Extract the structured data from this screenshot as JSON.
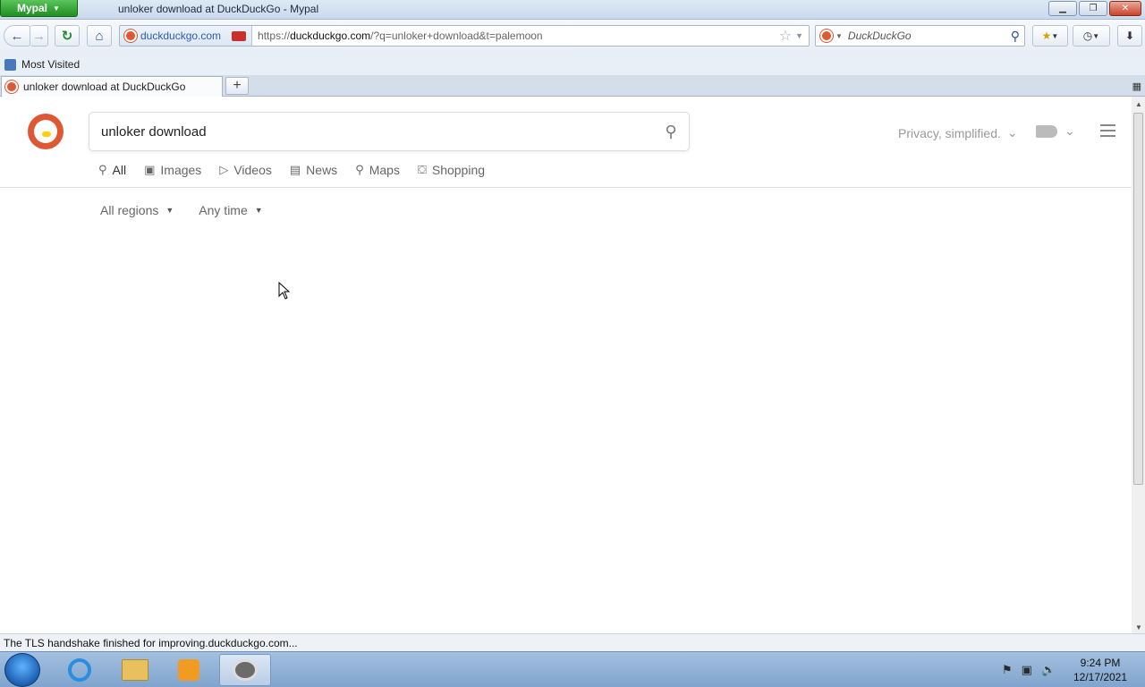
{
  "window": {
    "app_button": "Mypal",
    "title": "unloker download at DuckDuckGo - Mypal"
  },
  "navbar": {
    "identity_host": "duckduckgo.com",
    "url_scheme": "https://",
    "url_host": "duckduckgo.com",
    "url_path": "/?q=unloker+download&t=palemoon",
    "search_placeholder": "DuckDuckGo"
  },
  "bookmarks": {
    "items": [
      {
        "label": "Most Visited"
      }
    ]
  },
  "tabs": [
    {
      "label": "unloker download at DuckDuckGo"
    }
  ],
  "page": {
    "query": "unloker download",
    "privacy_text": "Privacy, simplified.",
    "nav_tabs": [
      {
        "label": "All",
        "icon": "search-icon"
      },
      {
        "label": "Images",
        "icon": "image-icon"
      },
      {
        "label": "Videos",
        "icon": "play-icon"
      },
      {
        "label": "News",
        "icon": "news-icon"
      },
      {
        "label": "Maps",
        "icon": "map-pin-icon"
      },
      {
        "label": "Shopping",
        "icon": "bag-icon"
      }
    ],
    "filters": [
      {
        "label": "All regions"
      },
      {
        "label": "Any time"
      }
    ]
  },
  "status": {
    "text": "The TLS handshake finished for improving.duckduckgo.com..."
  },
  "taskbar": {
    "time": "9:24 PM",
    "date": "12/17/2021"
  },
  "colors": {
    "ddg_brand": "#de5833",
    "taskbar": "#8fb0d6",
    "app_button": "#2e9e2e"
  }
}
